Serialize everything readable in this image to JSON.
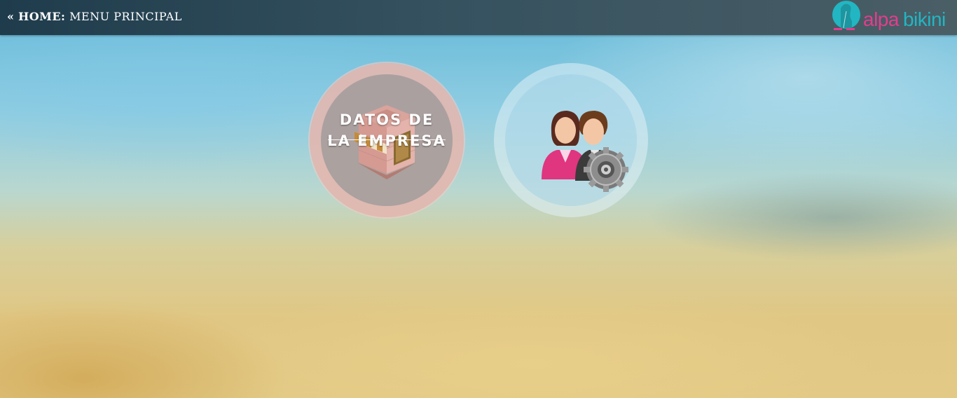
{
  "header": {
    "back_glyph": "«",
    "home_label": "HOME:",
    "section_title": "MENU PRINCIPAL",
    "logo": {
      "word_1": "alpa",
      "word_2": "bikini",
      "colors": {
        "pink": "#e33d8c",
        "teal": "#22b6c2"
      }
    }
  },
  "tiles": [
    {
      "label_line_1": "DATOS DE",
      "label_line_2": "LA EMPRESA",
      "icon": "shop-icon",
      "ring_color": "#e2b7b0"
    },
    {
      "icon": "users-gear-icon",
      "ring_color": "#e1f0f5"
    }
  ]
}
